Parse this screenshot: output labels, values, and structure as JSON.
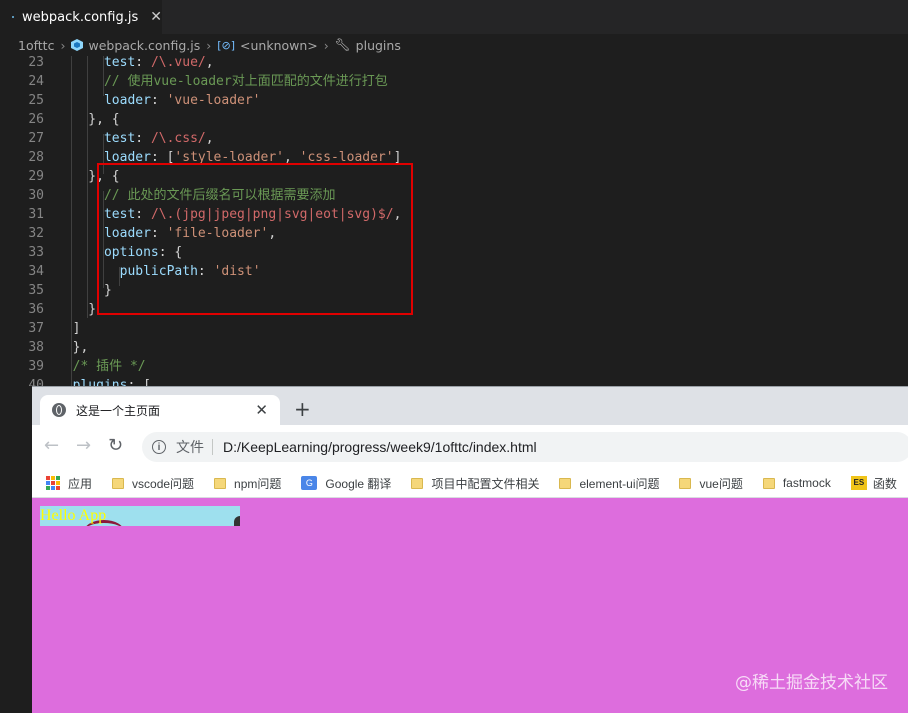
{
  "editor": {
    "tab": {
      "filename": "webpack.config.js",
      "close_glyph": "✕"
    },
    "breadcrumb": [
      {
        "label": "1ofttc"
      },
      {
        "label": "webpack.config.js"
      },
      {
        "label": "<unknown>"
      },
      {
        "label": "plugins"
      }
    ],
    "lines": [
      {
        "n": "23",
        "text": "      test: /\\.vue/,"
      },
      {
        "n": "24",
        "text": "      // 使用vue-loader对上面匹配的文件进行打包"
      },
      {
        "n": "25",
        "text": "      loader: 'vue-loader'"
      },
      {
        "n": "26",
        "text": "    }, {"
      },
      {
        "n": "27",
        "text": "      test: /\\.css/,"
      },
      {
        "n": "28",
        "text": "      loader: ['style-loader', 'css-loader']"
      },
      {
        "n": "29",
        "text": "    }, {"
      },
      {
        "n": "30",
        "text": "      // 此处的文件后缀名可以根据需要添加"
      },
      {
        "n": "31",
        "text": "      test: /\\.(jpg|jpeg|png|svg|eot|svg)$/,"
      },
      {
        "n": "32",
        "text": "      loader: 'file-loader',"
      },
      {
        "n": "33",
        "text": "      options: {"
      },
      {
        "n": "34",
        "text": "        publicPath: 'dist'"
      },
      {
        "n": "35",
        "text": "      }"
      },
      {
        "n": "36",
        "text": "    }"
      },
      {
        "n": "37",
        "text": "  ]"
      },
      {
        "n": "38",
        "text": "  },"
      },
      {
        "n": "39",
        "text": "  /* 插件 */"
      },
      {
        "n": "40",
        "text": "  plugins: ["
      }
    ]
  },
  "browser": {
    "tab_title": "这是一个主页面",
    "tab_close": "✕",
    "new_tab": "+",
    "nav": {
      "back": "←",
      "forward": "→",
      "reload": "↻"
    },
    "omnibox": {
      "scheme_label": "文件",
      "url": "D:/KeepLearning/progress/week9/1ofttc/index.html"
    },
    "bookmarks": [
      {
        "label": "应用",
        "icon": "apps-icon"
      },
      {
        "label": "vscode问题",
        "icon": "folder-icon"
      },
      {
        "label": "npm问题",
        "icon": "folder-icon"
      },
      {
        "label": "Google 翻译",
        "icon": "google-translate-icon"
      },
      {
        "label": "项目中配置文件相关",
        "icon": "folder-icon"
      },
      {
        "label": "element-ui问题",
        "icon": "folder-icon"
      },
      {
        "label": "vue问题",
        "icon": "folder-icon"
      },
      {
        "label": "fastmock",
        "icon": "folder-icon"
      },
      {
        "label": "函数",
        "icon": "es-icon"
      }
    ],
    "page": {
      "app_text": "Hello App",
      "background": "#dd6ddd",
      "box_color": "#9ee0ee",
      "text_color": "#ffff00"
    }
  },
  "watermark": "@稀土掘金技术社区"
}
